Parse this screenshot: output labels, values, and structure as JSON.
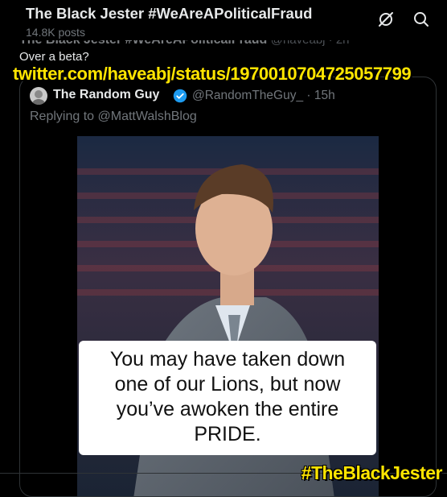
{
  "header": {
    "title": "The Black Jester #WeAreAPoliticalFraud",
    "subtitle": "14.8K posts",
    "icons": [
      "grok-icon",
      "search-icon"
    ]
  },
  "tweet": {
    "author_name": "The Black Jester #WeAreAPoliticalFraud",
    "author_handle": "@haveabj · 2h",
    "text": "Over a beta?"
  },
  "overlay": {
    "url": "twitter.com/haveabj/status/1970010704725057799",
    "hashtag": "#TheBlackJester",
    "color": "#ffe500"
  },
  "quote": {
    "name": "The Random Guy",
    "handle_time": "@RandomTheGuy_ · 15h",
    "replying_to": "Replying to @MattWalshBlog",
    "verified_color": "#1d9bf0",
    "media_caption": "You may have taken down\none of our Lions, but now\nyou’ve awoken the entire\nPRIDE."
  }
}
